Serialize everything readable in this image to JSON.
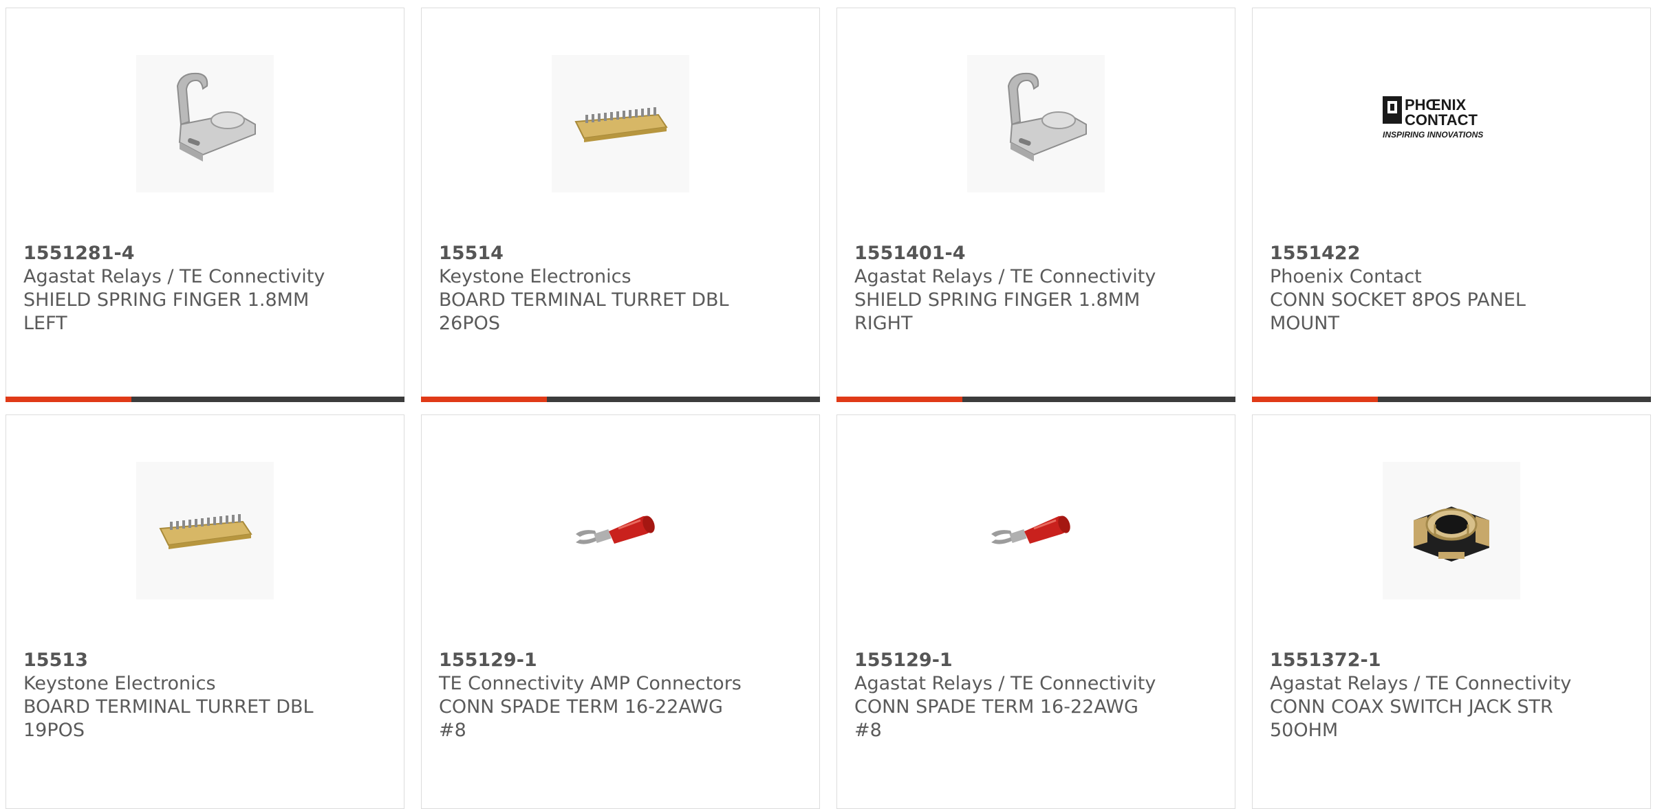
{
  "products": [
    {
      "part_number": "1551281-4",
      "manufacturer": "Agastat Relays / TE Connectivity",
      "description": "SHIELD SPRING FINGER 1.8MM LEFT",
      "image": "shield-spring-finger"
    },
    {
      "part_number": "15514",
      "manufacturer": "Keystone Electronics",
      "description": "BOARD TERMINAL TURRET DBL 26POS",
      "image": "turret-board-terminal"
    },
    {
      "part_number": "1551401-4",
      "manufacturer": "Agastat Relays / TE Connectivity",
      "description": "SHIELD SPRING FINGER 1.8MM RIGHT",
      "image": "shield-spring-finger"
    },
    {
      "part_number": "1551422",
      "manufacturer": "Phoenix Contact",
      "description": "CONN SOCKET 8POS PANEL MOUNT",
      "image": "phoenix-contact-logo",
      "logo_text": {
        "line1": "PHŒNIX",
        "line2": "CONTACT",
        "tagline": "INSPIRING INNOVATIONS"
      }
    },
    {
      "part_number": "15513",
      "manufacturer": "Keystone Electronics",
      "description": "BOARD TERMINAL TURRET DBL 19POS",
      "image": "turret-board-terminal"
    },
    {
      "part_number": "155129-1",
      "manufacturer": "TE Connectivity AMP Connectors",
      "description": "CONN SPADE TERM 16-22AWG #8",
      "image": "spade-terminal"
    },
    {
      "part_number": "155129-1",
      "manufacturer": "Agastat Relays / TE Connectivity",
      "description": "CONN SPADE TERM 16-22AWG #8",
      "image": "spade-terminal"
    },
    {
      "part_number": "1551372-1",
      "manufacturer": "Agastat Relays / TE Connectivity",
      "description": "CONN COAX SWITCH JACK STR 50OHM",
      "image": "coax-switch-jack"
    }
  ],
  "colors": {
    "accent": "#e03a17",
    "bar": "#3c3c3c",
    "text": "#5a5a5a",
    "border": "#dcdcdc"
  }
}
